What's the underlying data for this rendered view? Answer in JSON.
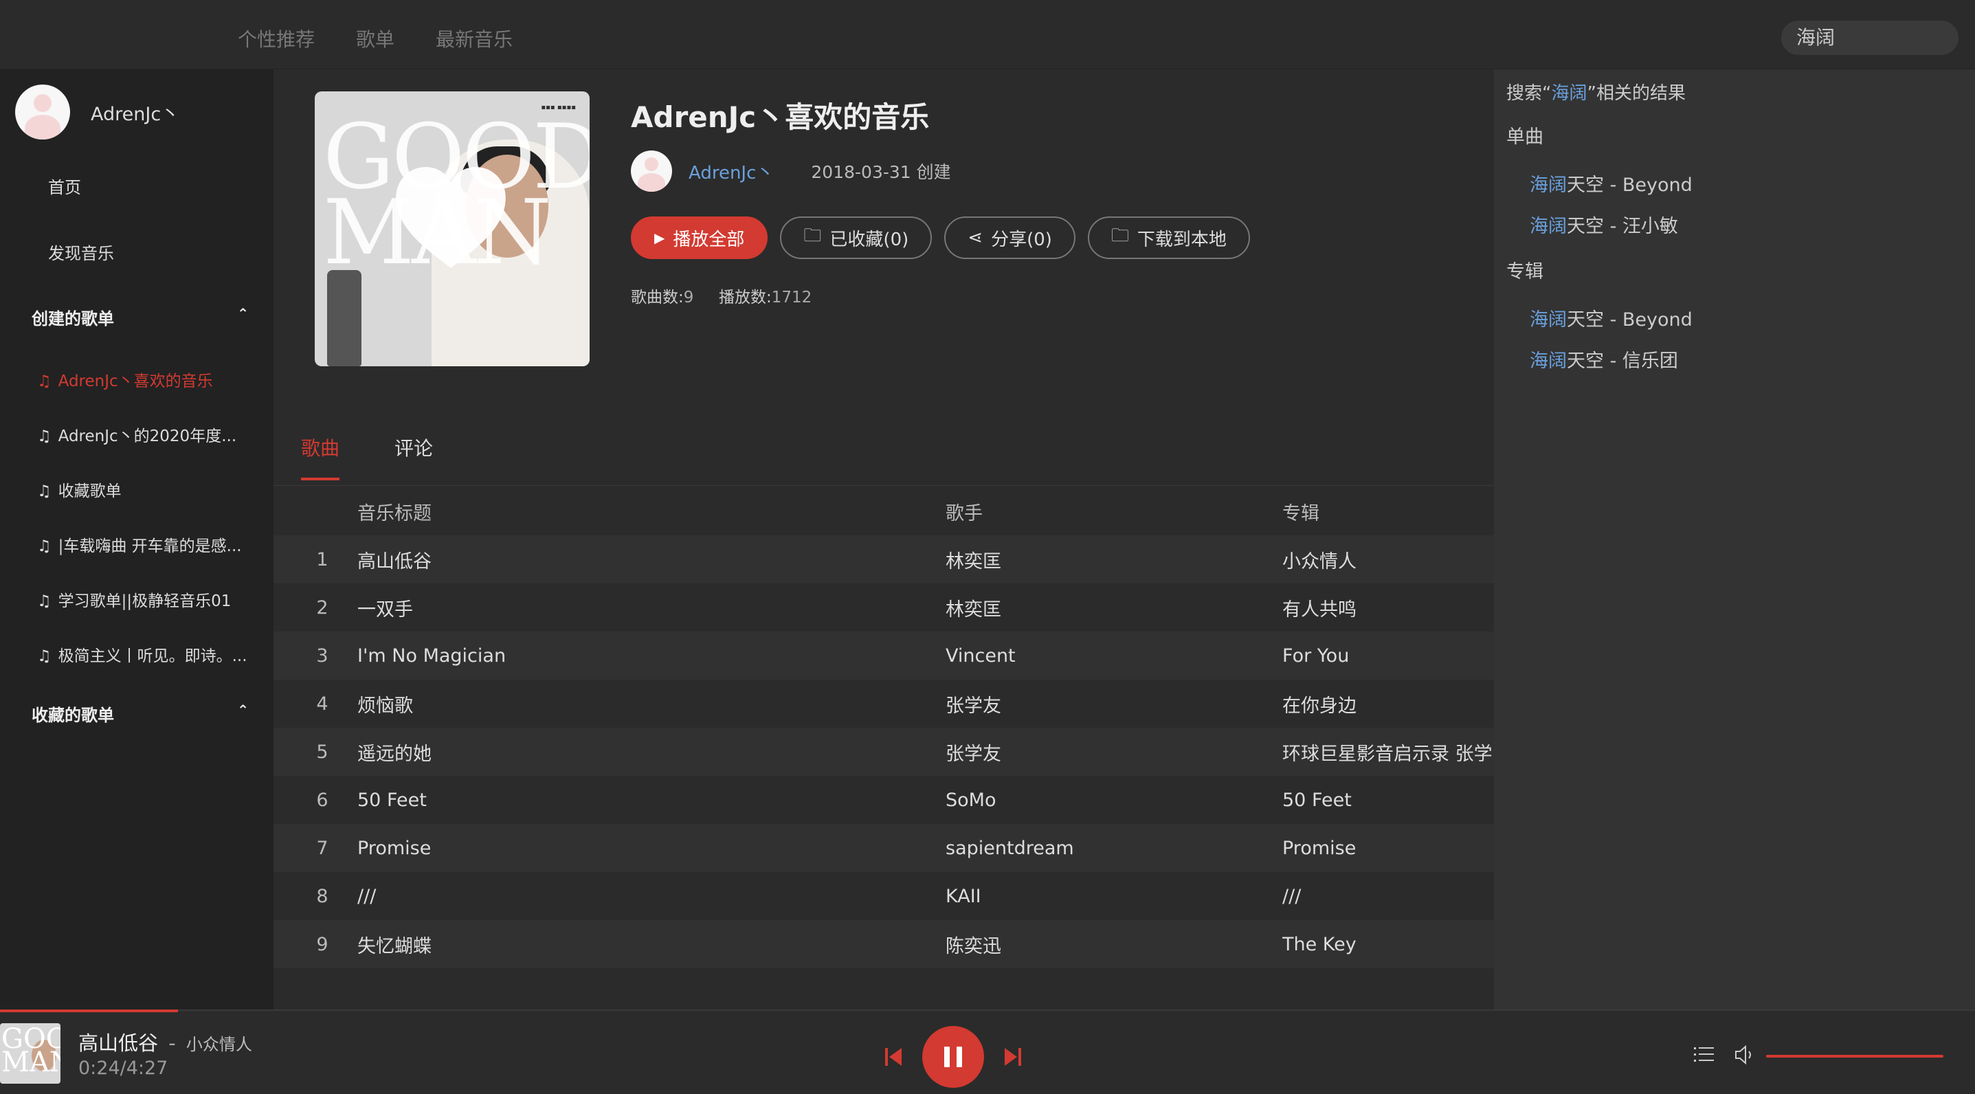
{
  "topnav": {
    "items": [
      "个性推荐",
      "歌单",
      "最新音乐"
    ]
  },
  "search": {
    "value": "海阔"
  },
  "sidebar": {
    "user_name": "AdrenJc丶",
    "links": [
      "首页",
      "发现音乐"
    ],
    "created_header": "创建的歌单",
    "created_playlists": [
      "AdrenJc丶喜欢的音乐",
      "AdrenJc丶的2020年度...",
      "收藏歌单",
      "|车载嗨曲 开车靠的是感...",
      "学习歌单||极静轻音乐01",
      "极简主义丨听见。即诗。..."
    ],
    "collected_header": "收藏的歌单",
    "collapse_icon": "chevron-up-icon"
  },
  "playlist": {
    "title": "AdrenJc丶喜欢的音乐",
    "creator": "AdrenJc丶",
    "created": "2018-03-31 创建",
    "buttons": {
      "play_all": "播放全部",
      "collected": "已收藏(0)",
      "share": "分享(0)",
      "download": "下载到本地"
    },
    "stats": {
      "song_count_label": "歌曲数:",
      "song_count": "9",
      "play_count_label": "播放数:",
      "play_count": "1712"
    },
    "cover_text": "GOOD MAN"
  },
  "tabs": [
    "歌曲",
    "评论"
  ],
  "table": {
    "headers": [
      "音乐标题",
      "歌手",
      "专辑"
    ],
    "rows": [
      {
        "idx": "1",
        "title": "高山低谷",
        "artist": "林奕匡",
        "album": "小众情人"
      },
      {
        "idx": "2",
        "title": "一双手",
        "artist": "林奕匡",
        "album": "有人共鸣"
      },
      {
        "idx": "3",
        "title": "I'm No Magician",
        "artist": "Vincent",
        "album": "For You"
      },
      {
        "idx": "4",
        "title": "烦恼歌",
        "artist": "张学友",
        "album": "在你身边"
      },
      {
        "idx": "5",
        "title": "遥远的她",
        "artist": "张学友",
        "album": "环球巨星影音启示录 张学"
      },
      {
        "idx": "6",
        "title": "50 Feet",
        "artist": "SoMo",
        "album": "50 Feet"
      },
      {
        "idx": "7",
        "title": "Promise",
        "artist": "sapientdream",
        "album": "Promise"
      },
      {
        "idx": "8",
        "title": "///",
        "artist": "KAII",
        "album": "///"
      },
      {
        "idx": "9",
        "title": "失忆蝴蝶",
        "artist": "陈奕迅",
        "album": "The Key"
      }
    ]
  },
  "search_results": {
    "prefix": "搜索“",
    "keyword": "海阔",
    "suffix": "”相关的结果",
    "singles_header": "单曲",
    "singles": [
      {
        "kw": "海阔",
        "rest": "天空 - Beyond"
      },
      {
        "kw": "海阔",
        "rest": "天空 - 汪小敏"
      }
    ],
    "albums_header": "专辑",
    "albums": [
      {
        "kw": "海阔",
        "rest": "天空 - Beyond"
      },
      {
        "kw": "海阔",
        "rest": "天空 - 信乐团"
      }
    ]
  },
  "player": {
    "song": "高山低谷",
    "separator": "-",
    "artist": "小众情人",
    "time": "0:24/4:27",
    "progress": 0.09,
    "volume": 1.0,
    "accent": "#d33a31"
  }
}
